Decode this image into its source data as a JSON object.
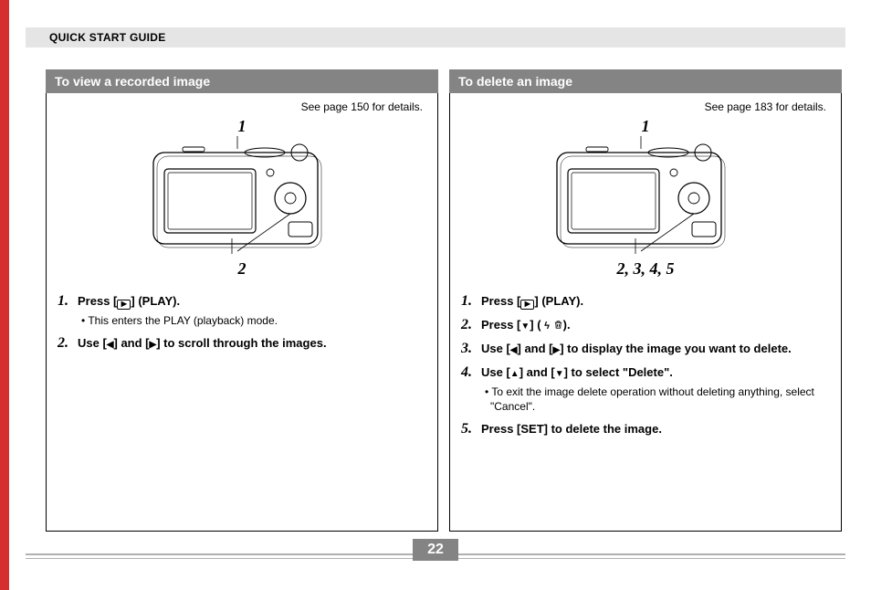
{
  "header": "QUICK START GUIDE",
  "page_number": "22",
  "left_panel": {
    "title": "To view a recorded image",
    "details": "See page 150 for details.",
    "callout_top": "1",
    "callout_bottom": "2",
    "steps": [
      {
        "num": "1.",
        "main_pre": "Press [",
        "icon": "play",
        "main_post": "] (PLAY).",
        "sub": "• This enters the PLAY (playback) mode."
      },
      {
        "num": "2.",
        "main_pre": "Use [",
        "arrow1": "◀",
        "main_mid": "] and [",
        "arrow2": "▶",
        "main_post": "] to scroll through the images."
      }
    ]
  },
  "right_panel": {
    "title": "To delete an image",
    "details": "See page 183 for details.",
    "callout_top": "1",
    "callout_bottom": "2, 3, 4, 5",
    "steps": [
      {
        "num": "1.",
        "main_pre": "Press [",
        "icon": "play",
        "main_post": "] (PLAY)."
      },
      {
        "num": "2.",
        "main_pre": "Press [",
        "arrow1": "▼",
        "main_mid": "] ( ",
        "icon2_a": "⚡",
        "icon2_b": "trash",
        "main_post": ")."
      },
      {
        "num": "3.",
        "main_pre": "Use [",
        "arrow1": "◀",
        "main_mid": "] and [",
        "arrow2": "▶",
        "main_post": "] to display the image you want to delete."
      },
      {
        "num": "4.",
        "main_pre": "Use [",
        "arrow1": "▲",
        "main_mid": "] and [",
        "arrow2": "▼",
        "main_post": "] to select \"Delete\".",
        "sub": "• To exit the image delete operation without deleting anything, select \"Cancel\"."
      },
      {
        "num": "5.",
        "main_plain": "Press [SET] to delete the image."
      }
    ]
  }
}
